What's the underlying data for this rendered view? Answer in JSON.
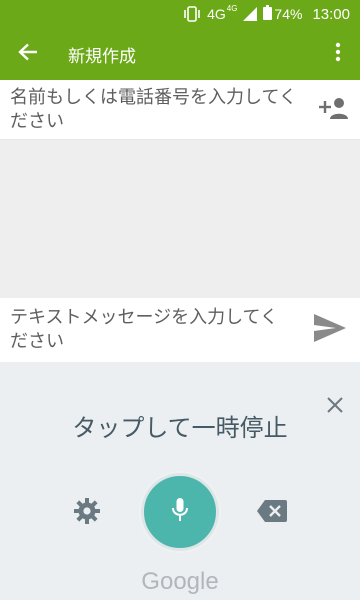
{
  "status_bar": {
    "network": "4G",
    "network_sup": "4G",
    "battery": "74%",
    "time": "13:00"
  },
  "app_bar": {
    "title": "新規作成",
    "back_icon": "arrow-back-icon",
    "menu_icon": "more-vert-icon"
  },
  "recipient": {
    "placeholder": "名前もしくは電話番号を入力してください",
    "add_contact_icon": "person-add-icon"
  },
  "compose": {
    "placeholder": "テキストメッセージを入力してください",
    "send_icon": "send-icon"
  },
  "voice_input": {
    "status": "タップして一時停止",
    "brand": "Google",
    "icons": [
      "close-icon",
      "settings-icon",
      "mic-icon",
      "backspace-icon"
    ]
  },
  "colors": {
    "app_bar": "#6ca918",
    "mic_button": "#4db6ac",
    "voice_panel_bg": "#eceff1",
    "voice_status_text": "#455a64"
  }
}
